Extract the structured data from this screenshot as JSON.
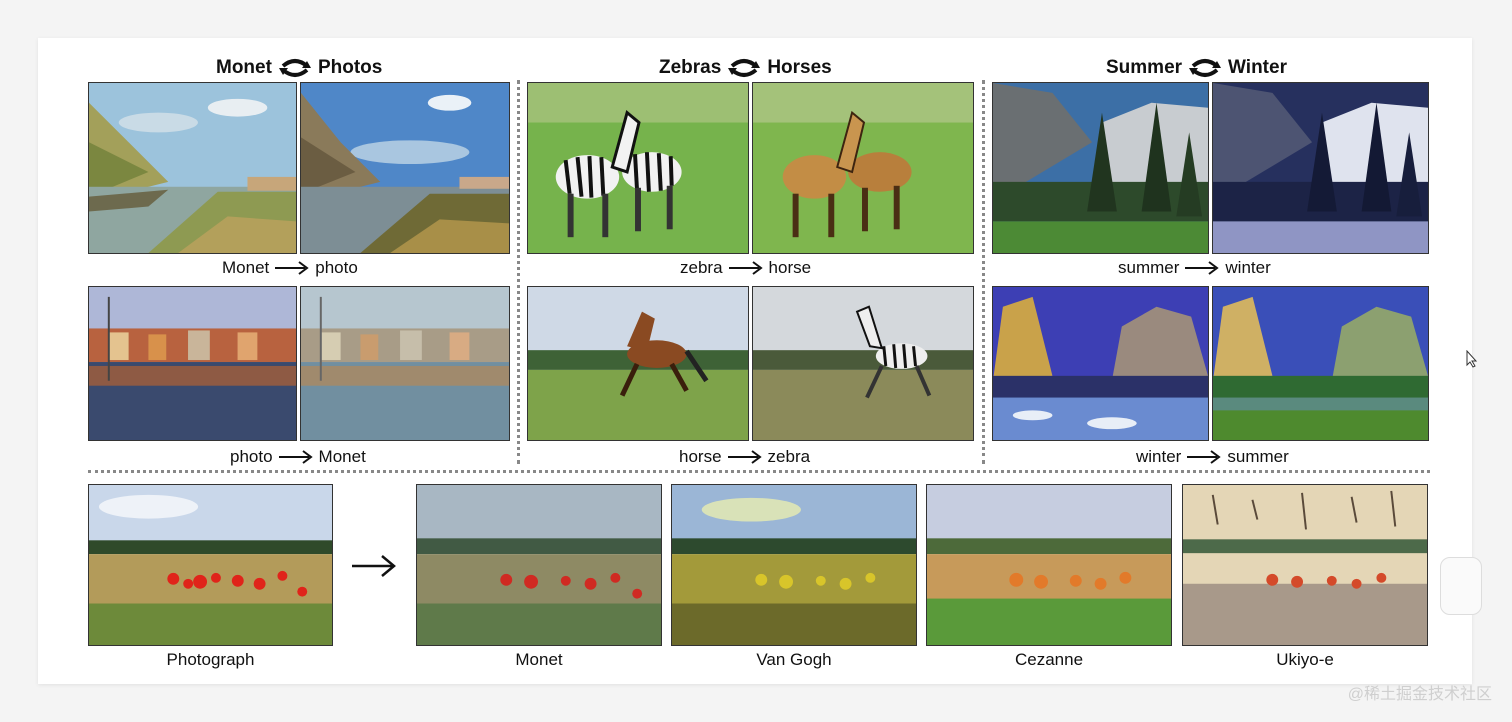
{
  "sections": [
    {
      "left": "Monet",
      "right": "Photos",
      "icon": "swap-arrows-icon"
    },
    {
      "left": "Zebras",
      "right": "Horses",
      "icon": "swap-arrows-icon"
    },
    {
      "left": "Summer",
      "right": "Winter",
      "icon": "swap-arrows-icon"
    }
  ],
  "captions": [
    {
      "from": "Monet",
      "to": "photo"
    },
    {
      "from": "zebra",
      "to": "horse"
    },
    {
      "from": "summer",
      "to": "winter"
    },
    {
      "from": "photo",
      "to": "Monet"
    },
    {
      "from": "horse",
      "to": "zebra"
    },
    {
      "from": "winter",
      "to": "summer"
    }
  ],
  "bottom_row": {
    "source_label": "Photograph",
    "style_labels": [
      "Monet",
      "Van Gogh",
      "Cezanne",
      "Ukiyo-e"
    ]
  },
  "watermark": "@稀土掘金技术社区",
  "icons": {
    "arrow": "right-arrow-icon",
    "cursor": "mouse-cursor-icon"
  }
}
